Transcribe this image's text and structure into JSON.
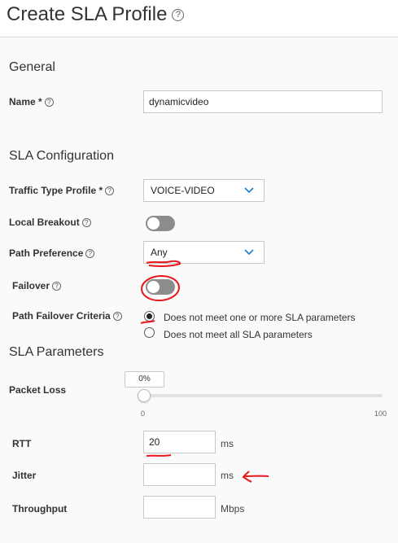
{
  "header": {
    "title": "Create SLA Profile",
    "help": "?"
  },
  "general": {
    "section_title": "General",
    "name_label": "Name *",
    "name_value": "dynamicvideo"
  },
  "sla_config": {
    "section_title": "SLA Configuration",
    "traffic_type_label": "Traffic Type Profile *",
    "traffic_type_value": "VOICE-VIDEO",
    "local_breakout_label": "Local Breakout",
    "local_breakout_on": false,
    "path_pref_label": "Path Preference",
    "path_pref_value": "Any",
    "failover_label": "Failover",
    "failover_on": false,
    "path_failover_label": "Path Failover Criteria",
    "criteria_options": [
      "Does not meet one or more SLA parameters",
      "Does not meet all SLA parameters"
    ],
    "criteria_selected": 0
  },
  "sla_params": {
    "section_title": "SLA Parameters",
    "packet_loss_label": "Packet Loss",
    "packet_loss_value": "0%",
    "packet_loss_min": "0",
    "packet_loss_max": "100",
    "rtt_label": "RTT",
    "rtt_value": "20",
    "rtt_unit": "ms",
    "jitter_label": "Jitter",
    "jitter_value": "",
    "jitter_unit": "ms",
    "throughput_label": "Throughput",
    "throughput_value": "",
    "throughput_unit": "Mbps"
  },
  "colors": {
    "annotation": "#e8181e",
    "toggle_off": "#8c8c8c",
    "chevron": "#1f7ad1"
  },
  "icons": [
    "help-icon",
    "chevron-down-icon",
    "toggle-switch"
  ]
}
